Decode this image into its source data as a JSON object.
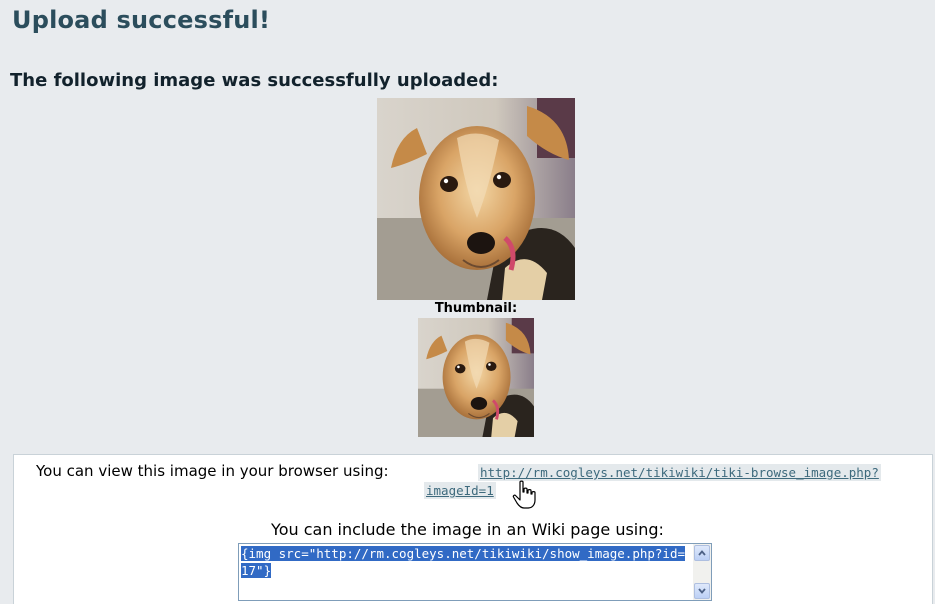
{
  "header": {
    "title": "Upload successful!",
    "subtitle": "The following image was successfully uploaded:"
  },
  "images": {
    "thumbnail_label": "Thumbnail:"
  },
  "view": {
    "text": "You can view this image in your browser using:",
    "link_line1": "http://rm.cogleys.net/tikiwiki/tiki-browse_image.php?",
    "link_line2": "imageId=1"
  },
  "include": {
    "text": "You can include the image in an Wiki page using:",
    "code": "{img src=\"http://rm.cogleys.net/tikiwiki/show_image.php?id=17\"}"
  },
  "icons": {
    "cursor": "hand-pointer-icon",
    "scroll_up": "chevron-up-icon",
    "scroll_down": "chevron-down-icon"
  },
  "colors": {
    "panel_bg": "#e8ebee",
    "title": "#2b4d5c",
    "link": "#3e6a7d",
    "selection": "#316ac5"
  }
}
